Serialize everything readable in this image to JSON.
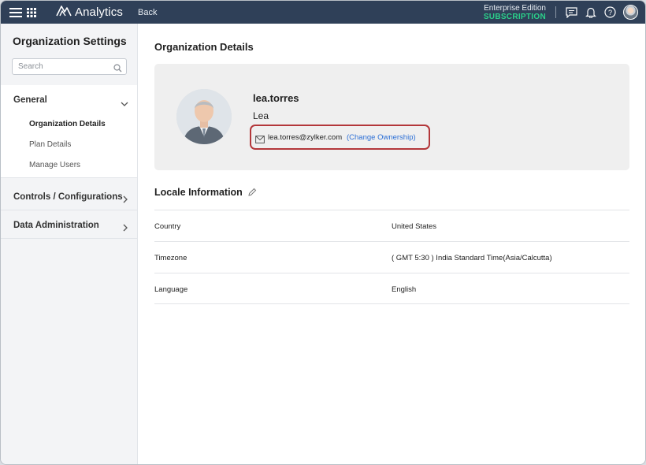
{
  "topbar": {
    "app_name": "Analytics",
    "back_label": "Back",
    "edition_name": "Enterprise Edition",
    "edition_sub": "SUBSCRIPTION",
    "accent": "#2bd08a",
    "bg": "#2f4058"
  },
  "sidebar": {
    "title": "Organization Settings",
    "search_placeholder": "Search",
    "groups": [
      {
        "label": "General",
        "expanded": true,
        "items": [
          {
            "label": "Organization Details",
            "active": true
          },
          {
            "label": "Plan Details",
            "active": false
          },
          {
            "label": "Manage Users",
            "active": false
          }
        ]
      },
      {
        "label": "Controls / Configurations",
        "expanded": false
      },
      {
        "label": "Data Administration",
        "expanded": false
      }
    ]
  },
  "main": {
    "title": "Organization Details",
    "profile": {
      "username": "lea.torres",
      "display_name": "Lea",
      "email": "lea.torres@zylker.com",
      "change_ownership": "(Change Ownership)"
    },
    "locale": {
      "title": "Locale Information",
      "rows": [
        {
          "key": "Country",
          "value": "United States"
        },
        {
          "key": "Timezone",
          "value": "( GMT 5:30 ) India Standard Time(Asia/Calcutta)"
        },
        {
          "key": "Language",
          "value": "English"
        }
      ]
    }
  },
  "icons": [
    "menu-icon",
    "apps-grid-icon",
    "analytics-logo-icon",
    "chat-icon",
    "bell-icon",
    "help-icon",
    "user-avatar",
    "search-icon",
    "chevron-down-icon",
    "chevron-right-icon",
    "mail-icon",
    "pencil-icon"
  ]
}
